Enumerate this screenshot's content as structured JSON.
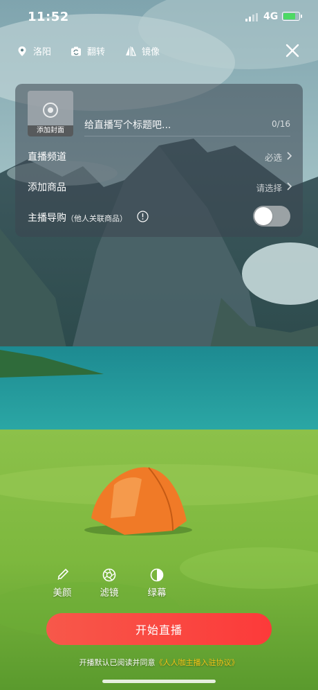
{
  "status_bar": {
    "time": "11:52",
    "network": "4G",
    "battery_level": 0.7,
    "battery_charging": true
  },
  "toolbar": {
    "location_label": "洛阳",
    "flip_label": "翻转",
    "mirror_label": "镜像",
    "icons": {
      "location": "location-pin-icon",
      "flip": "camera-flip-icon",
      "mirror": "mirror-icon",
      "close": "close-icon"
    }
  },
  "settings": {
    "cover_label": "添加封面",
    "title_placeholder": "给直播写个标题吧...",
    "title_value": "",
    "title_counter": "0/16",
    "channel_label": "直播频道",
    "channel_value": "必选",
    "goods_label": "添加商品",
    "goods_value": "请选择",
    "guide_label": "主播导购",
    "guide_sub": "（他人关联商品）",
    "guide_enabled": false
  },
  "tools": [
    {
      "label": "美颜",
      "icon": "beauty-brush-icon"
    },
    {
      "label": "滤镜",
      "icon": "filter-aperture-icon"
    },
    {
      "label": "绿幕",
      "icon": "green-screen-icon"
    }
  ],
  "start_button_label": "开始直播",
  "agreement": {
    "prefix": "开播默认已阅读并同意",
    "link": "《人人咖主播入驻协议》"
  },
  "colors": {
    "start_button": "#f7584a",
    "agreement_link": "#f5c518",
    "panel_bg": "rgba(60,70,80,0.55)"
  }
}
